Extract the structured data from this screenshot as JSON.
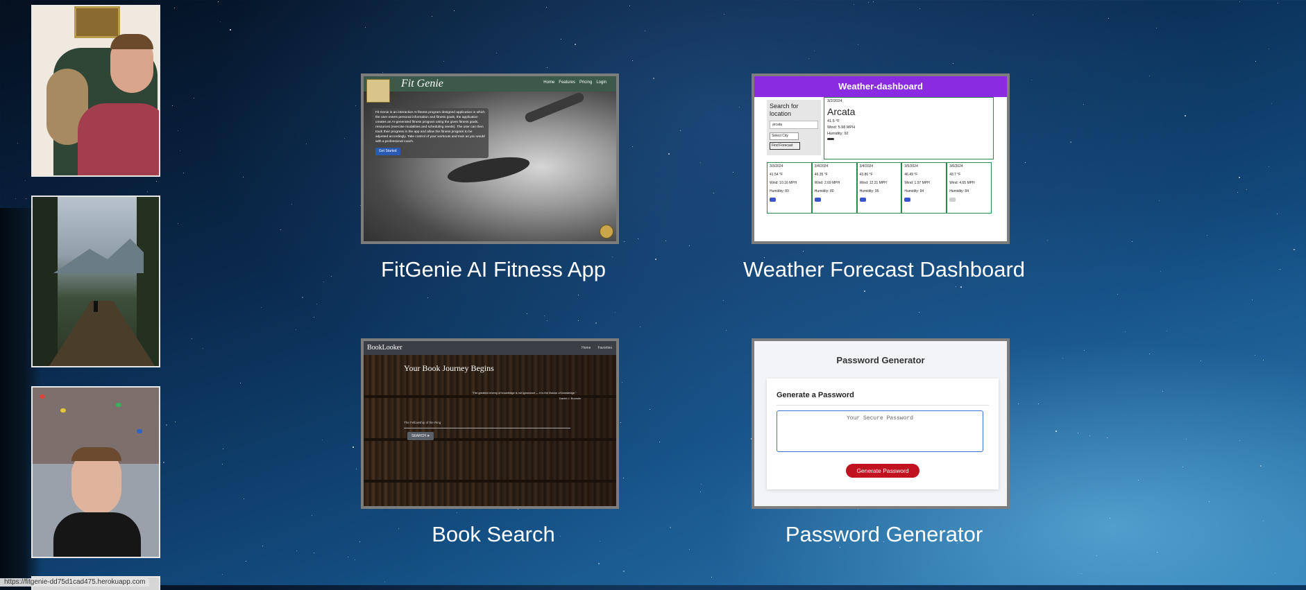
{
  "projects": [
    {
      "caption": "FitGenie AI Fitness App"
    },
    {
      "caption": "Weather Forecast Dashboard"
    },
    {
      "caption": "Book Search"
    },
    {
      "caption": "Password Generator"
    }
  ],
  "fitgenie_preview": {
    "title": "Fit Genie",
    "nav": [
      "Home",
      "Features",
      "Pricing",
      "Login"
    ],
    "description": "Fit Genie is an interactive AI fitness program designed application in which the user enters personal information and fitness goals, the application creates an AI-generated fitness program using the given fitness goals, resources (exercise modalities and scheduling needs). The user can then track their progress in the app and allow the fitness program to be adjusted accordingly. Take control of your workouts and train as you would with a professional coach.",
    "cta": "Get Started"
  },
  "weather_preview": {
    "header": "Weather-dashboard",
    "search_label": "Search for location",
    "search_value": "arcata",
    "select_label": "Select City",
    "forecast_button": "Find Forecast",
    "current": {
      "date": "3/2/2024",
      "city": "Arcata",
      "temp": "41.5 °F",
      "wind": "Wind: 5.98 MPH",
      "humidity": "Humidity: 92"
    },
    "days": [
      {
        "date": "3/3/2024",
        "temp": "41.54 °F",
        "wind": "Wind: 10.16 MPH",
        "humidity": "Humidity: 83"
      },
      {
        "date": "3/4/2024",
        "temp": "46.35 °F",
        "wind": "Wind: 2.69 MPH",
        "humidity": "Humidity: 80"
      },
      {
        "date": "3/4/2024",
        "temp": "43.86 °F",
        "wind": "Wind: 12.31 MPH",
        "humidity": "Humidity: 95"
      },
      {
        "date": "3/5/2024",
        "temp": "46.49 °F",
        "wind": "Wind: 1.97 MPH",
        "humidity": "Humidity: 94"
      },
      {
        "date": "3/6/2024",
        "temp": "43.7 °F",
        "wind": "Wind: 4.65 MPH",
        "humidity": "Humidity: 84"
      }
    ]
  },
  "book_preview": {
    "brand": "BookLooker",
    "nav": [
      "Home",
      "Favorites"
    ],
    "headline": "Your Book Journey Begins",
    "quote": "\"The greatest enemy of knowledge is not ignorance — it is the illusion of knowledge.\"",
    "author": "Daniel J. Boorstin",
    "input_value": "The Fellowship of the Ring",
    "search_button": "SEARCH"
  },
  "password_preview": {
    "title": "Password Generator",
    "subtitle": "Generate a Password",
    "placeholder": "Your Secure Password",
    "button": "Generate Password"
  },
  "status_url": "https://fitgenie-dd75d1cad475.herokuapp.com"
}
